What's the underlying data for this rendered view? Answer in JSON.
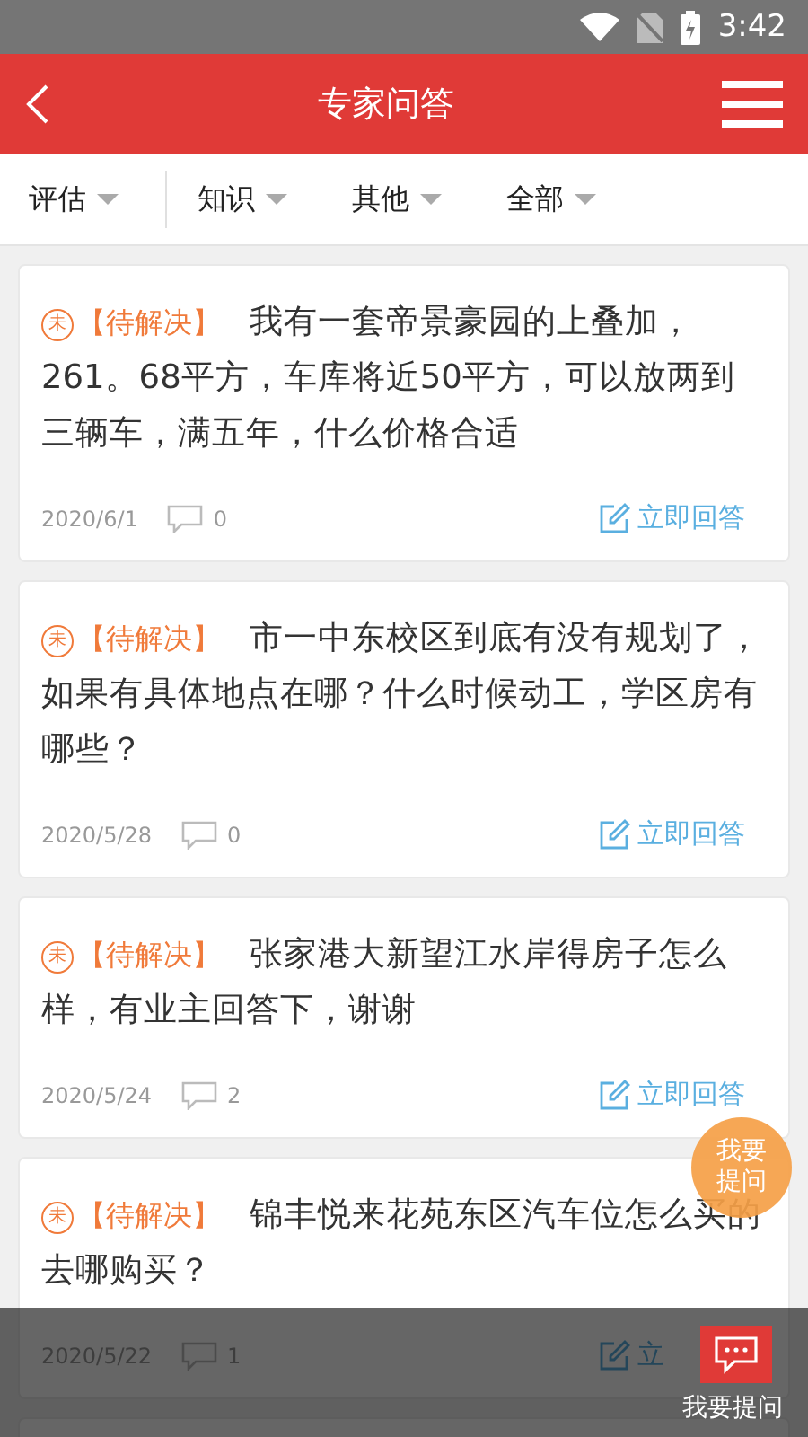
{
  "status_bar": {
    "time": "3:42"
  },
  "header": {
    "title": "专家问答"
  },
  "filters": [
    {
      "label": "评估"
    },
    {
      "label": "知识"
    },
    {
      "label": "其他"
    },
    {
      "label": "全部"
    }
  ],
  "questions": [
    {
      "mark": "未",
      "status": "【待解决】",
      "text": "我有一套帝景豪园的上叠加，261。68平方，车库将近50平方，可以放两到三辆车，满五年，什么价格合适",
      "date": "2020/6/1",
      "comments": "0",
      "answer": "立即回答"
    },
    {
      "mark": "未",
      "status": "【待解决】",
      "text": "市一中东校区到底有没有规划了，如果有具体地点在哪？什么时候动工，学区房有哪些？",
      "date": "2020/5/28",
      "comments": "0",
      "answer": "立即回答"
    },
    {
      "mark": "未",
      "status": "【待解决】",
      "text": "张家港大新望江水岸得房子怎么样，有业主回答下，谢谢",
      "date": "2020/5/24",
      "comments": "2",
      "answer": "立即回答"
    },
    {
      "mark": "未",
      "status": "【待解决】",
      "text": "锦丰悦来花苑东区汽车位怎么买的去哪购买？",
      "date": "2020/5/22",
      "comments": "1",
      "answer": "立"
    }
  ],
  "float_button": {
    "label": "我要提问"
  },
  "bottom_bar": {
    "label": "我要提问"
  }
}
